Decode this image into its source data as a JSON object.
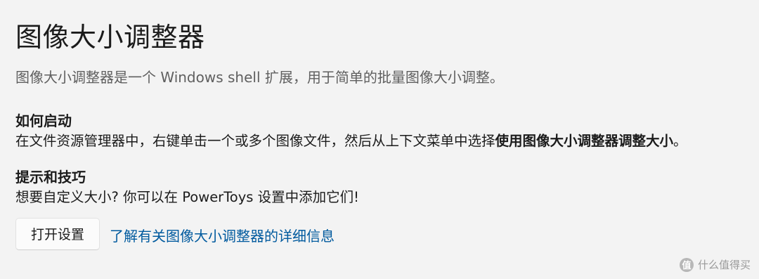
{
  "page": {
    "title": "图像大小调整器",
    "description": "图像大小调整器是一个 Windows shell 扩展，用于简单的批量图像大小调整。"
  },
  "how_to_start": {
    "heading": "如何启动",
    "body_text": "在文件资源管理器中，右键单击一个或多个图像文件，然后从上下文菜单中选择",
    "body_bold": "使用图像大小调整器调整大小",
    "body_end": "。"
  },
  "tips": {
    "heading": "提示和技巧",
    "body": "想要自定义大小? 你可以在 PowerToys 设置中添加它们!"
  },
  "actions": {
    "open_settings_label": "打开设置",
    "learn_more_label": "了解有关图像大小调整器的详细信息"
  },
  "watermark": {
    "logo_glyph": "值",
    "text": "什么值得买"
  }
}
